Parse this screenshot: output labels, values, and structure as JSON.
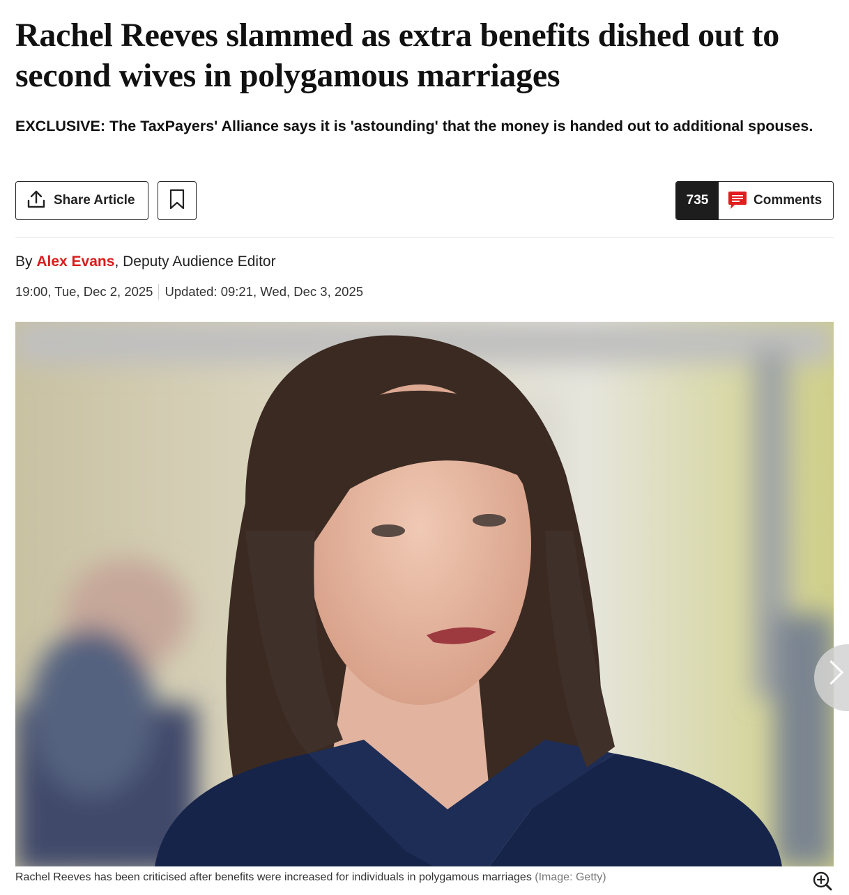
{
  "article": {
    "headline": "Rachel Reeves slammed as extra benefits dished out to second wives in polygamous marriages",
    "standfirst": "EXCLUSIVE: The TaxPayers' Alliance says it is 'astounding' that the money is handed out to additional spouses."
  },
  "actions": {
    "share_label": "Share Article",
    "share_icon": "share-upload-icon",
    "bookmark_icon": "bookmark-icon",
    "comment_count": "735",
    "comments_label": "Comments",
    "comments_icon": "comment-bubble-icon",
    "comments_icon_color": "#e11d1d"
  },
  "byline": {
    "prefix": "By",
    "author": "Alex Evans",
    "role": ", Deputy Audience Editor",
    "author_color": "#d81d1d"
  },
  "dates": {
    "published": "19:00, Tue, Dec 2, 2025",
    "updated": "Updated: 09:21, Wed, Dec 3, 2025"
  },
  "image": {
    "caption": "Rachel Reeves has been criticised after benefits were increased for individuals in polygamous marriages",
    "credit": "(Image: Getty)",
    "next_icon": "chevron-right-icon",
    "zoom_icon": "zoom-in-icon"
  }
}
